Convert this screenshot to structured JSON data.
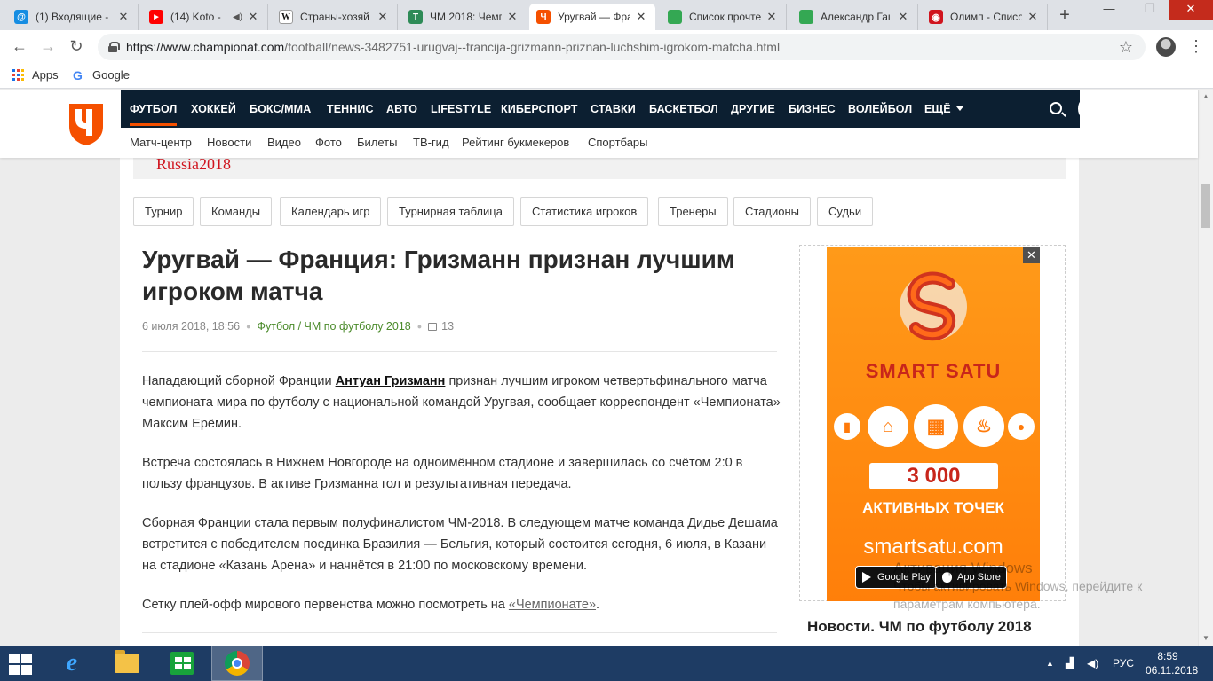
{
  "browser": {
    "tabs": [
      {
        "title": "(1) Входящие -",
        "favicon": "mail-icon",
        "color": "#168de2",
        "glyph": "@"
      },
      {
        "title": "(14) Koto -",
        "favicon": "youtube-icon",
        "color": "#ff0000",
        "glyph": "▶"
      },
      {
        "title": "Страны-хозяй",
        "favicon": "wikipedia-icon",
        "color": "#ffffff",
        "glyph": "W"
      },
      {
        "title": "ЧМ 2018: Чемп",
        "favicon": "sheet-icon",
        "color": "#2e8b57",
        "glyph": "T"
      },
      {
        "title": "Уругвай — Фра",
        "favicon": "championat-icon",
        "color": "#f55000",
        "glyph": "Ч"
      },
      {
        "title": "Список прочте",
        "favicon": "sheets-icon",
        "color": "#34a853",
        "glyph": ""
      },
      {
        "title": "Александр Гаш",
        "favicon": "sheets-icon",
        "color": "#34a853",
        "glyph": ""
      },
      {
        "title": "Олимп - Списо",
        "favicon": "olymp-icon",
        "color": "#d0141e",
        "glyph": "◉"
      }
    ],
    "url": {
      "host": "https://www.championat.com",
      "path": "/football/news-3482751-urugvaj--francija-grizmann-priznan-luchshim-igrokom-matcha.html"
    },
    "bookmarks": [
      {
        "label": "Apps"
      },
      {
        "label": "Google"
      }
    ]
  },
  "site": {
    "nav": [
      "ФУТБОЛ",
      "ХОККЕЙ",
      "БОКС/ММА",
      "ТЕННИС",
      "АВТО",
      "LIFESTYLE",
      "КИБЕРСПОРТ",
      "СТАВКИ",
      "БАСКЕТБОЛ",
      "ДРУГИЕ",
      "БИЗНЕС",
      "ВОЛЕЙБОЛ",
      "ЕЩЁ"
    ],
    "subnav": [
      "Матч-центр",
      "Новости",
      "Видео",
      "Фото",
      "Билеты",
      "ТВ-гид",
      "Рейтинг букмекеров",
      "Спортбары"
    ],
    "brand_color": "#f55000",
    "navbar_color": "#0c1f31"
  },
  "article": {
    "banner_text": "Russia2018",
    "pills": [
      "Турнир",
      "Команды",
      "Календарь игр",
      "Турнирная таблица",
      "Статистика игроков",
      "Тренеры",
      "Стадионы",
      "Судьи"
    ],
    "title": "Уругвай — Франция: Гризманн признан лучшим игроком матча",
    "date": "6 июля 2018, 18:56",
    "category": "Футбол / ЧМ по футболу 2018",
    "comments": "13",
    "p1_before": "Нападающий сборной Франции ",
    "p1_link": "Антуан Гризманн",
    "p1_after": " признан лучшим игроком четвертьфинального матча чемпионата мира по футболу с национальной командой Уругвая, сообщает корреспондент «Чемпионата» Максим Ерёмин.",
    "p2": "Встреча состоялась в Нижнем Новгороде на одноимённом стадионе и завершилась со счётом 2:0 в пользу французов. В активе Гризманна гол и результативная передача.",
    "p3": "Сборная Франции стала первым полуфиналистом ЧМ-2018. В следующем матче команда Дидье Дешама встретится с победителем поединка Бразилия — Бельгия, который состоится сегодня, 6 июля, в Казани на стадионе «Казань Арена» и начнётся в 21:00 по московскому времени.",
    "p4_before": "Сетку плей-офф мирового первенства можно посмотреть на ",
    "p4_link": "«Чемпионате»",
    "p4_after": "."
  },
  "ad": {
    "close": "✕",
    "brand": "SMART SATU",
    "number": "3 000",
    "tagline": "АКТИВНЫХ ТОЧЕК",
    "url": "smartsatu.com",
    "google_play": "Google Play",
    "app_store": "App Store"
  },
  "sidebar": {
    "title": "Новости. ЧМ по футболу 2018"
  },
  "watermark": {
    "line1": "Активация Windows",
    "line2": "Чтобы активировать Windows, перейдите к параметрам компьютера."
  },
  "taskbar": {
    "lang": "РУС",
    "time": "8:59",
    "date": "06.11.2018"
  }
}
